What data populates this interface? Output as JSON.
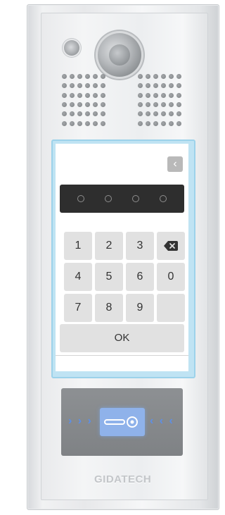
{
  "keypad": {
    "back_label": "‹",
    "pin_slots": 4,
    "keys": [
      "1",
      "2",
      "3",
      "4",
      "5",
      "6",
      "0",
      "7",
      "8",
      "9"
    ],
    "ok_label": "OK"
  },
  "card_reader": {
    "arrows_left": "› › ›",
    "arrows_right": "‹ ‹ ‹"
  },
  "brand": {
    "name": "GIDATECH"
  },
  "colors": {
    "screen_border": "#9cd2ea",
    "pin_display_bg": "#2e2e2e",
    "key_bg": "#e1e1e1",
    "card_zone": "#8fb2ea",
    "arrow": "#5d8fe6"
  },
  "icons": {
    "backspace": "backspace-icon",
    "back": "back-arrow-icon",
    "card": "key-card-icon"
  }
}
